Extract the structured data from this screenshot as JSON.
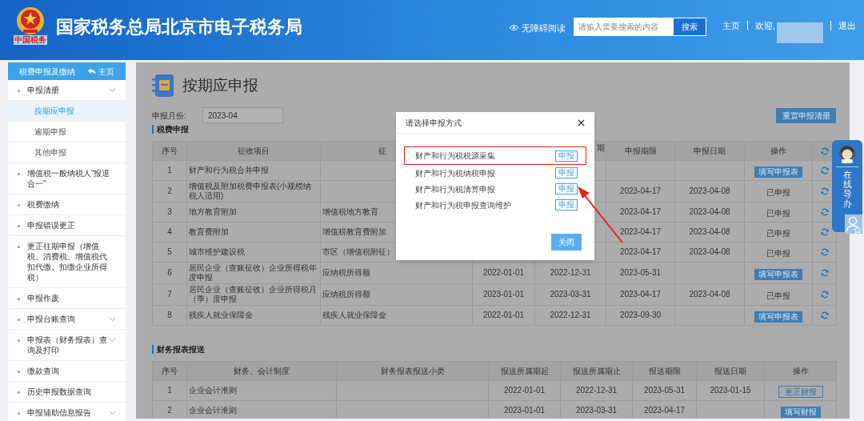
{
  "header": {
    "logo_text": "中国税务",
    "title": "国家税务总局北京市电子税务局",
    "accessibility": "无障碍阅读",
    "search": {
      "placeholder": "请输入需要搜索的内容",
      "button": "搜索"
    },
    "home": "主页",
    "welcome": "欢迎,",
    "logout": "退出"
  },
  "sidebar": {
    "title": "税费申报及缴纳",
    "home": "主页",
    "items": [
      {
        "kind": "group",
        "label": "申报清册",
        "selected": false,
        "children": [
          {
            "label": "按期应申报",
            "selected": true
          },
          {
            "label": "逾期申报",
            "selected": false
          },
          {
            "label": "其他申报",
            "selected": false
          }
        ]
      },
      {
        "kind": "link",
        "label": "增值税一般纳税人“报退合一”",
        "selected": false
      },
      {
        "kind": "link",
        "label": "税费缴纳",
        "selected": false
      },
      {
        "kind": "link",
        "label": "申报错误更正",
        "selected": false
      },
      {
        "kind": "link",
        "label": "更正往期申报（增值税、消费税、增值税代扣代缴、扣缴企业所得税）",
        "selected": false
      },
      {
        "kind": "link",
        "label": "申报作废",
        "selected": false
      },
      {
        "kind": "group",
        "label": "申报台账查询",
        "selected": false
      },
      {
        "kind": "group",
        "label": "申报表（财务报表）查询及打印",
        "selected": false
      },
      {
        "kind": "link",
        "label": "缴款查询",
        "selected": false
      },
      {
        "kind": "link",
        "label": "历史申报数据查询",
        "selected": false
      },
      {
        "kind": "group",
        "label": "申报辅助信息报告",
        "selected": false
      }
    ]
  },
  "page": {
    "title": "按期应申报",
    "month_label": "申报月份:",
    "month": "2023-04",
    "reset_button": "重置申报清册"
  },
  "tax_section": {
    "title": "税费申报",
    "columns": [
      "序号",
      "征收项目",
      "征",
      null,
      "期",
      "申报期限",
      "申报日期",
      "操作"
    ],
    "rows": [
      {
        "cells": [
          "1",
          "财产和行为税合并申报",
          null,
          null,
          null,
          null,
          null
        ],
        "action": {
          "kind": "button",
          "text": "填写申报表"
        }
      },
      {
        "cells": [
          "2",
          "增值税及附加税费申报表(小规模纳税人适用)",
          null,
          null,
          null,
          "2023-04-17",
          "2023-04-08"
        ],
        "action": {
          "kind": "text",
          "text": "已申报"
        }
      },
      {
        "cells": [
          "3",
          "地方教育附加",
          "增值税地方教育",
          null,
          null,
          "2023-04-17",
          "2023-04-08"
        ],
        "action": {
          "kind": "text",
          "text": "已申报"
        }
      },
      {
        "cells": [
          "4",
          "教育费附加",
          "增值税教育费附加",
          null,
          null,
          "2023-04-17",
          "2023-04-08"
        ],
        "action": {
          "kind": "text",
          "text": "已申报"
        }
      },
      {
        "cells": [
          "5",
          "城市维护建设税",
          "市区（增值税附征）",
          null,
          null,
          "2023-04-17",
          "2023-04-08"
        ],
        "action": {
          "kind": "text",
          "text": "已申报"
        }
      },
      {
        "cells": [
          "6",
          "居民企业（查账征收）企业所得税年度申报",
          "应纳税所得额",
          "2022-01-01",
          "2022-12-31",
          "2023-05-31",
          null
        ],
        "action": {
          "kind": "button",
          "text": "填写申报表"
        }
      },
      {
        "cells": [
          "7",
          "居民企业（查账征收）企业所得税月（季）度申报",
          "应纳税所得额",
          "2023-01-01",
          "2023-03-31",
          "2023-04-17",
          "2023-04-08"
        ],
        "action": {
          "kind": "text",
          "text": "已申报"
        }
      },
      {
        "cells": [
          "8",
          "残疾人就业保障金",
          "残疾人就业保障金",
          "2022-01-01",
          "2022-12-31",
          "2023-09-30",
          null
        ],
        "action": {
          "kind": "button",
          "text": "填写申报表"
        }
      }
    ]
  },
  "finance_section": {
    "title": "财务报表报送",
    "columns": [
      "序号",
      "财务、会计制度",
      "财务报表报送小类",
      "报送所属期起",
      "报送所属期止",
      "报送期限",
      "报送日期",
      "操作"
    ],
    "rows": [
      {
        "cells": [
          "1",
          "企业会计准则",
          null,
          "2022-01-01",
          "2022-12-31",
          "2023-05-31",
          "2023-01-15"
        ],
        "action": {
          "kind": "outline",
          "text": "更正财报"
        }
      },
      {
        "cells": [
          "2",
          "企业会计准则",
          null,
          "2023-01-01",
          "2023-03-31",
          "2023-04-17",
          null
        ],
        "action": {
          "kind": "button",
          "text": "填写财报"
        }
      }
    ]
  },
  "modal": {
    "title": "请选择申报方式",
    "options": [
      {
        "label": "财产和行为税税源采集",
        "button": "申报",
        "highlighted": true
      },
      {
        "label": "财产和行为税纳税申报",
        "button": "申报",
        "highlighted": false
      },
      {
        "label": "财产和行为税清算申报",
        "button": "申报",
        "highlighted": false
      },
      {
        "label": "财产和行为税申报查询维护",
        "button": "申报",
        "highlighted": false
      }
    ],
    "close_button": "关闭"
  },
  "guide_widget": {
    "text": "在线导办"
  }
}
